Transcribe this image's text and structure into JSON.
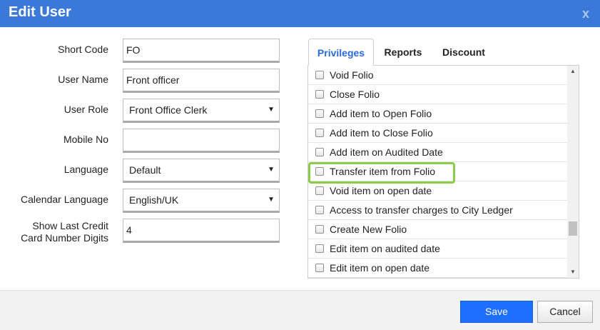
{
  "dialog": {
    "title": "Edit User",
    "close_label": "x"
  },
  "form": {
    "short_code": {
      "label": "Short Code",
      "value": "FO"
    },
    "user_name": {
      "label": "User Name",
      "value": "Front officer"
    },
    "user_role": {
      "label": "User Role",
      "value": "Front Office Clerk"
    },
    "mobile_no": {
      "label": "Mobile No",
      "value": ""
    },
    "language": {
      "label": "Language",
      "value": "Default"
    },
    "calendar_language": {
      "label": "Calendar Language",
      "value": "English/UK"
    },
    "show_last_cc": {
      "label_line1": "Show Last Credit",
      "label_line2": "Card Number Digits",
      "value": "4"
    }
  },
  "tabs": [
    {
      "label": "Privileges",
      "active": true
    },
    {
      "label": "Reports",
      "active": false
    },
    {
      "label": "Discount",
      "active": false
    }
  ],
  "privileges": [
    {
      "label": "Void Folio",
      "checked": false
    },
    {
      "label": "Close Folio",
      "checked": false
    },
    {
      "label": "Add item to Open Folio",
      "checked": false
    },
    {
      "label": "Add item to Close Folio",
      "checked": false
    },
    {
      "label": "Add item on Audited Date",
      "checked": false
    },
    {
      "label": "Transfer item from Folio",
      "checked": false,
      "highlighted": true
    },
    {
      "label": "Void item on open date",
      "checked": false
    },
    {
      "label": "Access to transfer charges to City Ledger",
      "checked": false
    },
    {
      "label": "Create New Folio",
      "checked": false
    },
    {
      "label": "Edit item on audited date",
      "checked": false
    },
    {
      "label": "Edit item on open date",
      "checked": false
    }
  ],
  "footer": {
    "save_label": "Save",
    "cancel_label": "Cancel"
  },
  "colors": {
    "titlebar": "#3a79d8",
    "accent": "#1f6fff",
    "highlight": "#8dcb4a",
    "active_tab": "#2a6ad8"
  }
}
